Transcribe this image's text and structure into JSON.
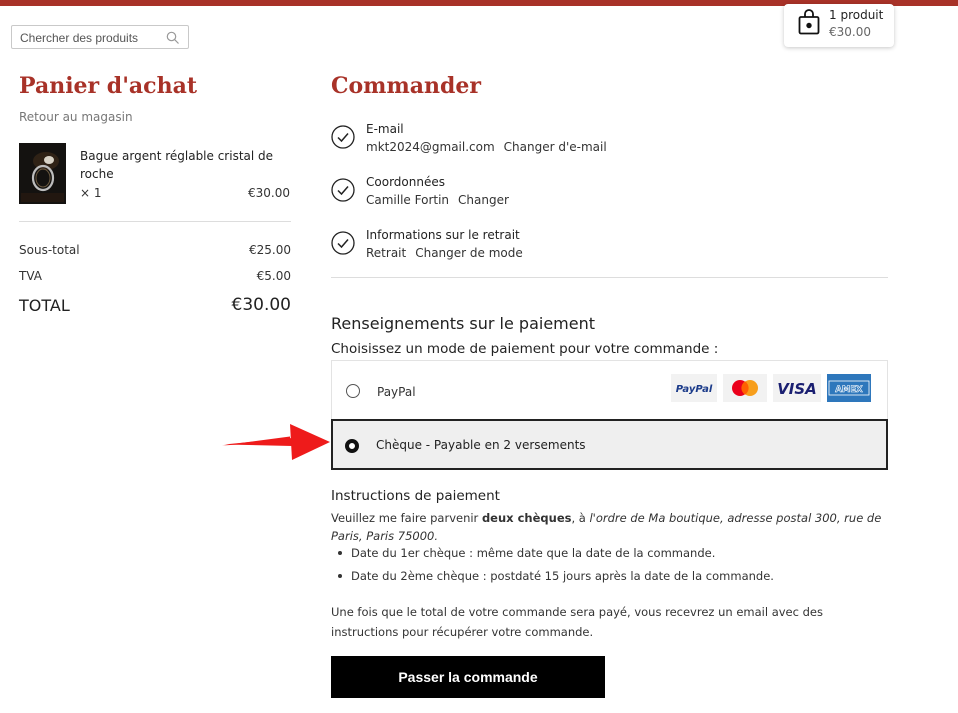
{
  "header": {
    "search_placeholder": "Chercher des produits",
    "cart": {
      "count": "1 produit",
      "amount": "€30.00"
    },
    "accent_color": "#a83228"
  },
  "cart_panel": {
    "title": "Panier d'achat",
    "back_link": "Retour au magasin",
    "item": {
      "name": "Bague argent réglable cristal de roche",
      "qty": "× 1",
      "price": "€30.00"
    },
    "subtotal_label": "Sous-total",
    "subtotal_value": "€25.00",
    "tax_label": "TVA",
    "tax_value": "€5.00",
    "total_label": "TOTAL",
    "total_value": "€30.00"
  },
  "checkout": {
    "title": "Commander",
    "steps": [
      {
        "label": "E-mail",
        "value": "mkt2024@gmail.com",
        "link": "Changer d'e-mail"
      },
      {
        "label": "Coordonnées",
        "value": "Camille Fortin",
        "link": "Changer"
      },
      {
        "label": "Informations sur le retrait",
        "value": "Retrait",
        "link": "Changer de mode"
      }
    ],
    "payment_title": "Renseignements sur le paiement",
    "payment_subtitle": "Choisissez un mode de paiement pour votre commande :",
    "payment_options": [
      {
        "label": "PayPal",
        "selected": false,
        "logos": [
          "PayPal",
          "mastercard",
          "VISA",
          "AMEX"
        ]
      },
      {
        "label": "Chèque - Payable en 2 versements",
        "selected": true
      }
    ],
    "instructions": {
      "title": "Instructions de paiement",
      "intro_1": "Veuillez me faire parvenir ",
      "intro_bold": "deux chèques",
      "intro_2": ", à ",
      "intro_italic": "l'ordre de Ma boutique, adresse postal 300, rue de Paris, Paris 75000.",
      "bullets": [
        "Date du 1er chèque : même date que la date de la commande.",
        "Date du 2ème chèque : postdaté 15 jours après la date de la commande."
      ],
      "note": "Une fois que le total de votre commande sera payé, vous recevrez un email avec des instructions pour récupérer votre commande."
    },
    "submit_label": "Passer la commande"
  }
}
